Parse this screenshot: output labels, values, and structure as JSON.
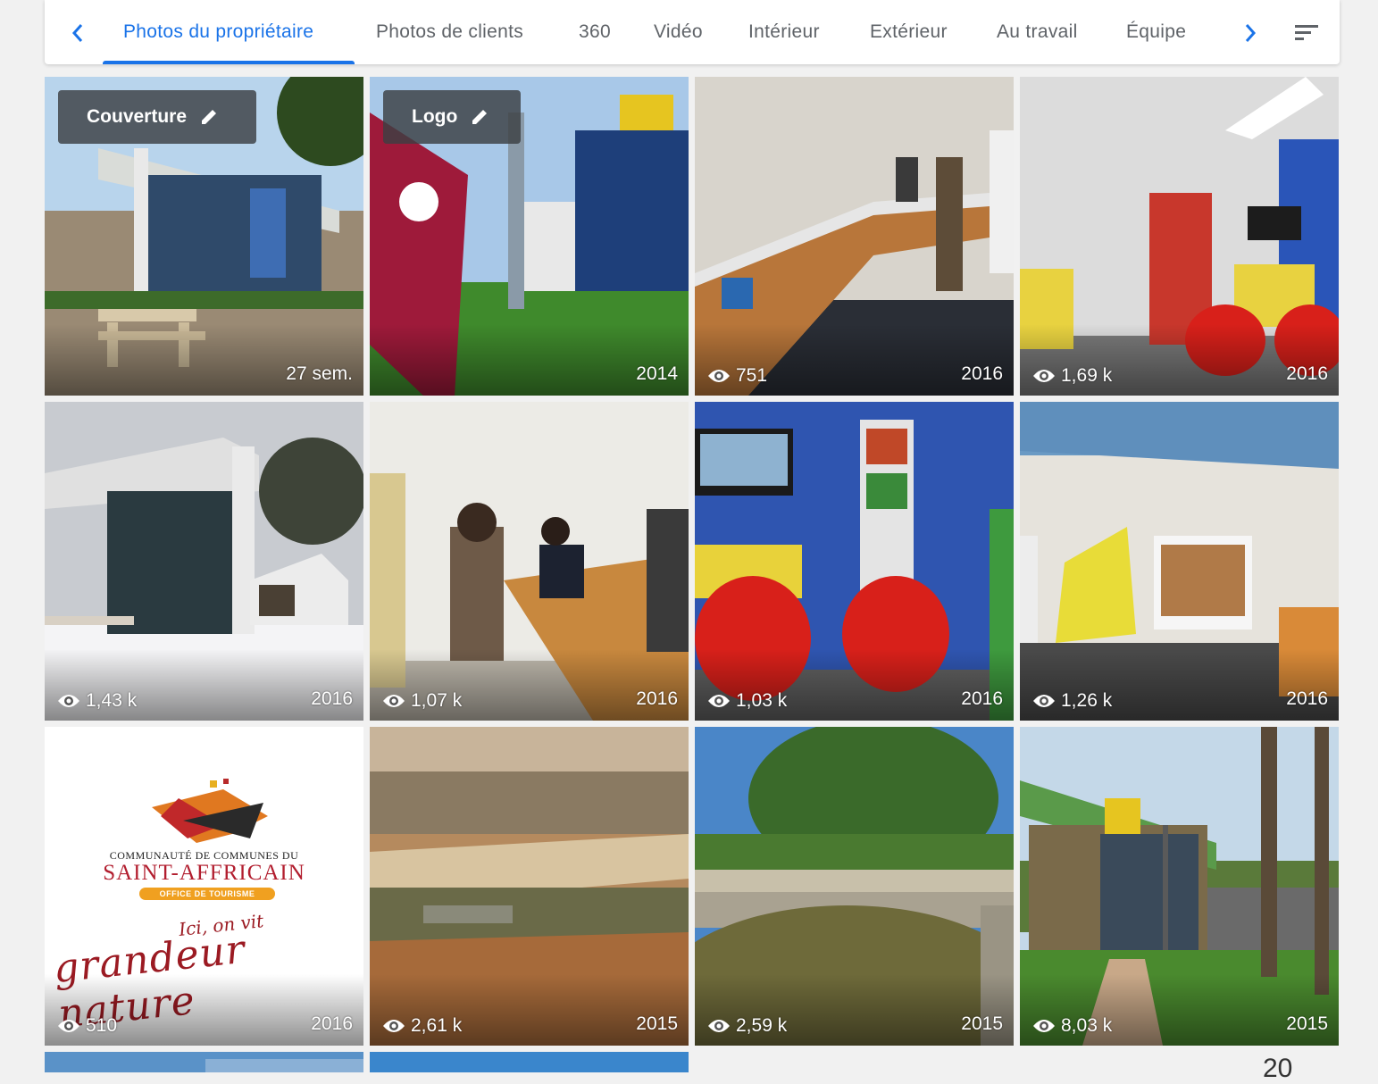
{
  "tabs": [
    {
      "label": "Photos du propriétaire",
      "active": true
    },
    {
      "label": "Photos de clients"
    },
    {
      "label": "360"
    },
    {
      "label": "Vidéo"
    },
    {
      "label": "Intérieur"
    },
    {
      "label": "Extérieur"
    },
    {
      "label": "Au travail"
    },
    {
      "label": "Équipe"
    }
  ],
  "icons": {
    "prev": "chevron-left-icon",
    "next": "chevron-right-icon",
    "filter": "sort-filter-icon",
    "edit": "pencil-icon",
    "views": "eye-icon"
  },
  "colors": {
    "accent": "#1a73e8",
    "tab_text": "#5f6368"
  },
  "photos": [
    {
      "badge": "Couverture",
      "year": "27 sem."
    },
    {
      "badge": "Logo",
      "year": "2014"
    },
    {
      "views": "751",
      "year": "2016"
    },
    {
      "views": "1,69 k",
      "year": "2016"
    },
    {
      "views": "1,43 k",
      "year": "2016"
    },
    {
      "views": "1,07 k",
      "year": "2016"
    },
    {
      "views": "1,03 k",
      "year": "2016"
    },
    {
      "views": "1,26 k",
      "year": "2016"
    },
    {
      "views": "510",
      "year": "2016"
    },
    {
      "views": "2,61 k",
      "year": "2015"
    },
    {
      "views": "2,59 k",
      "year": "2015"
    },
    {
      "views": "8,03 k",
      "year": "2015"
    }
  ],
  "logo_image": {
    "line1": "COMMUNAUTÉ DE COMMUNES DU",
    "line2": "SAINT-AFFRICAIN",
    "line3": "OFFICE DE TOURISME",
    "line4": "Ici, on vit",
    "line5": "grandeur nature"
  },
  "corner_number": "20"
}
